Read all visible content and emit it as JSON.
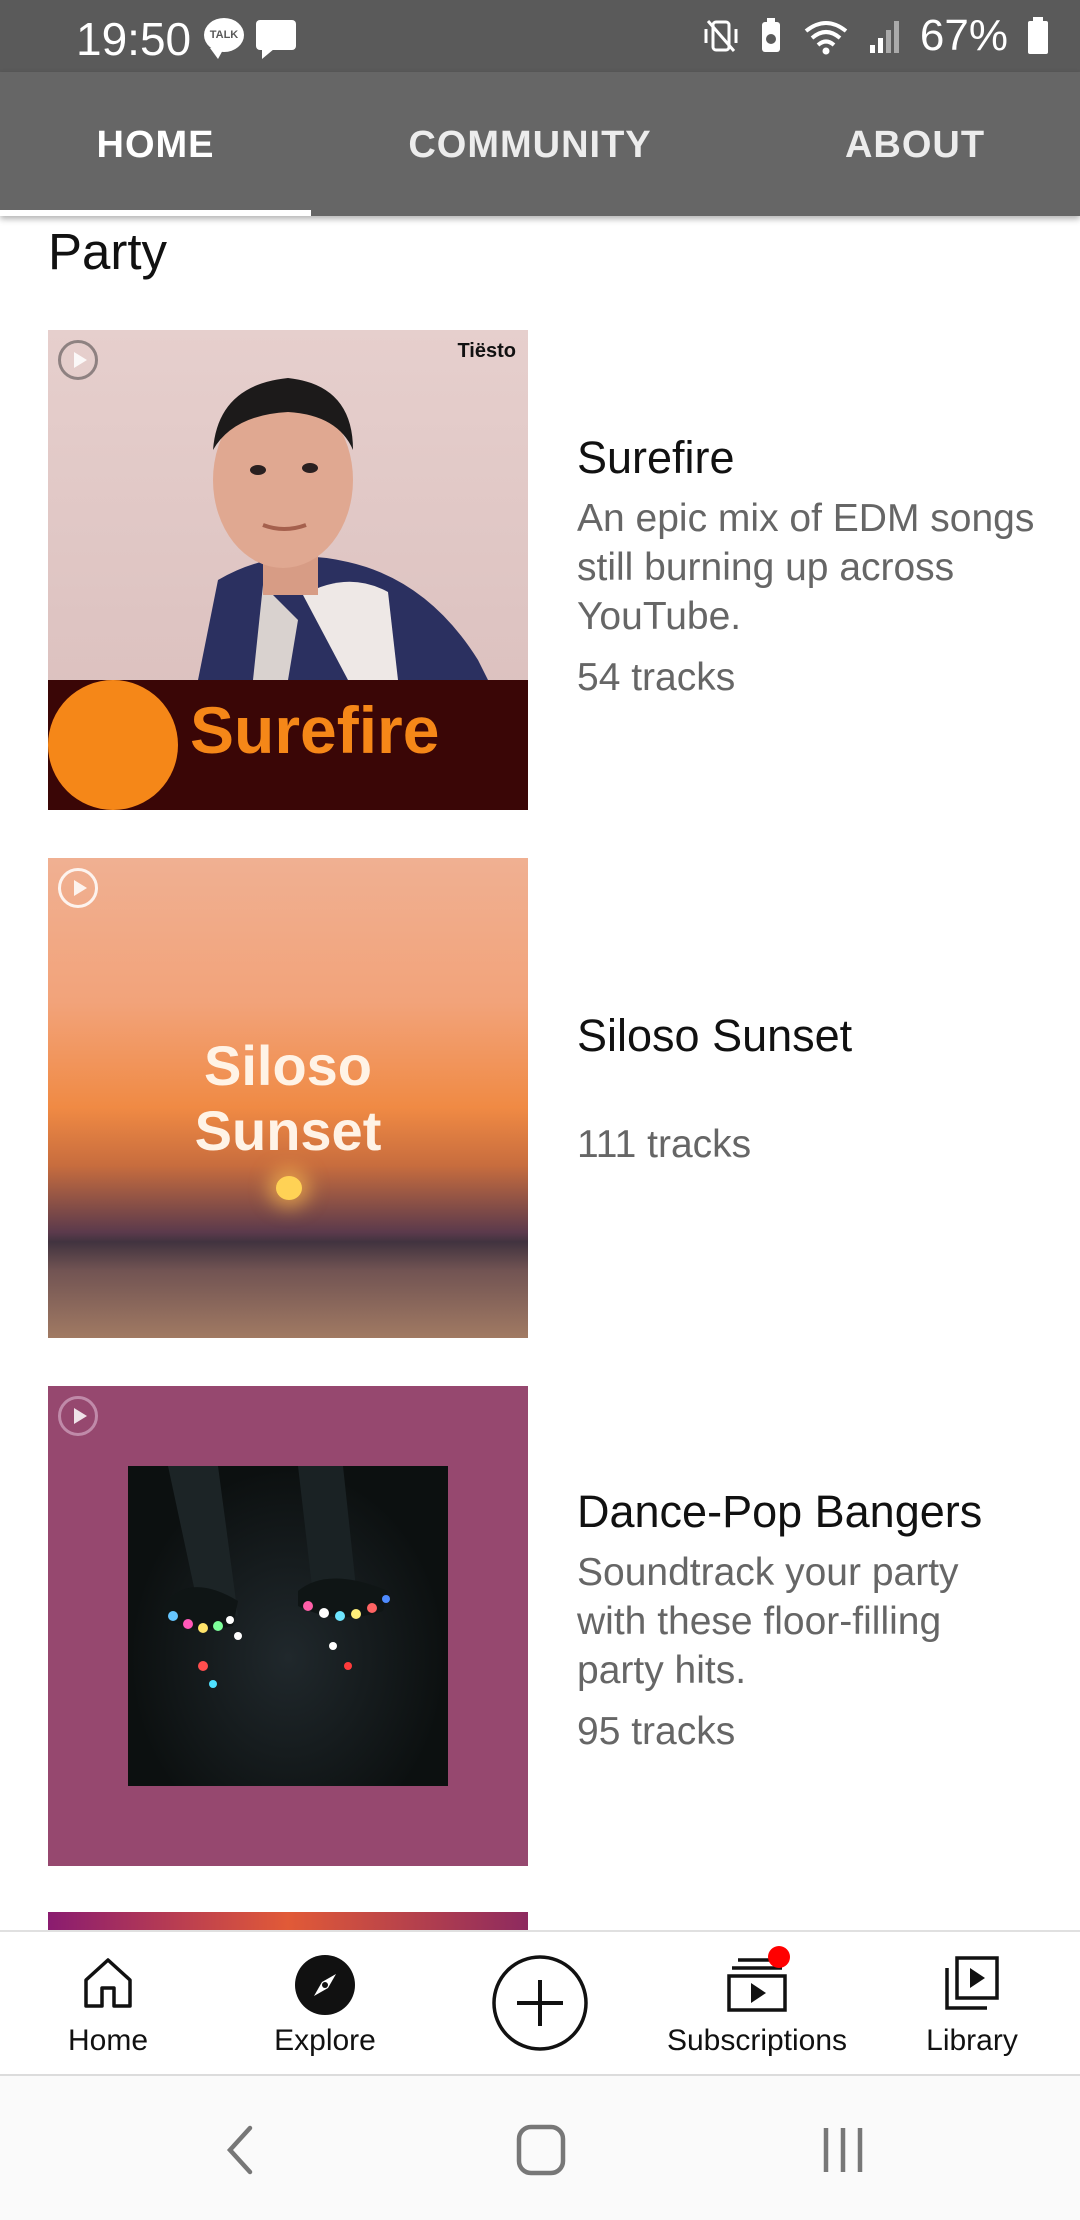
{
  "status_bar": {
    "time": "19:50",
    "talk_badge": "TALK",
    "battery": "67%",
    "icons": [
      "talk-icon",
      "message-icon",
      "vibrate-icon",
      "battery-saver-icon",
      "wifi-icon",
      "signal-icon",
      "battery-icon"
    ]
  },
  "tabs": [
    {
      "label": "HOME",
      "active": true
    },
    {
      "label": "COMMUNITY",
      "active": false
    },
    {
      "label": "ABOUT",
      "active": false
    }
  ],
  "section": {
    "title": "Party"
  },
  "playlists": [
    {
      "title": "Surefire",
      "description": "An epic mix of EDM songs still burning up across YouTube.",
      "tracks": "54 tracks",
      "art_text": "Surefire",
      "art_artist": "Tiësto",
      "accent": "#f58718"
    },
    {
      "title": "Siloso Sunset",
      "description": "",
      "tracks": "111 tracks",
      "art_text_line1": "Siloso",
      "art_text_line2": "Sunset"
    },
    {
      "title": "Dance-Pop Bangers",
      "description": "Soundtrack your party with these floor-filling party hits.",
      "tracks": "95 tracks",
      "background": "#96486f"
    }
  ],
  "bottom_nav": [
    {
      "label": "Home",
      "icon": "home-icon"
    },
    {
      "label": "Explore",
      "icon": "explore-icon"
    },
    {
      "label": "",
      "icon": "create-icon"
    },
    {
      "label": "Subscriptions",
      "icon": "subscriptions-icon",
      "notification_dot": "#ff0000"
    },
    {
      "label": "Library",
      "icon": "library-icon"
    }
  ],
  "system_nav": {
    "icons": [
      "back-icon",
      "home-button-icon",
      "recents-icon"
    ]
  }
}
